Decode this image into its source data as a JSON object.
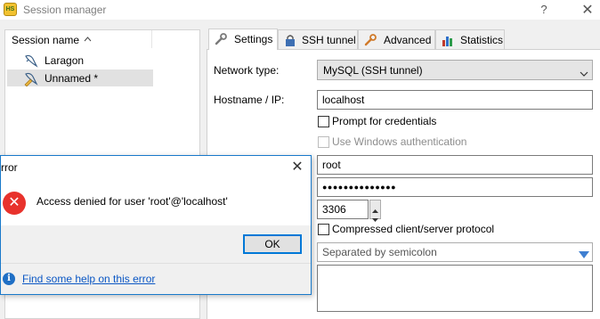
{
  "window": {
    "title": "Session manager",
    "app_icon_text": "HS",
    "help_label": "?",
    "close_label": "✕"
  },
  "sessions": {
    "column_header": "Session name",
    "sort_glyph": "^",
    "items": [
      {
        "label": "Laragon",
        "icon": "dolphin-icon",
        "selected": false
      },
      {
        "label": "Unnamed *",
        "icon": "dolphin-edit-icon",
        "selected": true
      }
    ]
  },
  "tabs": [
    {
      "label": "Settings",
      "icon": "wrench-icon",
      "active": true
    },
    {
      "label": "SSH tunnel",
      "icon": "lock-icon",
      "active": false
    },
    {
      "label": "Advanced",
      "icon": "wrench-icon",
      "active": false
    },
    {
      "label": "Statistics",
      "icon": "bar-chart-icon",
      "active": false
    }
  ],
  "settings": {
    "network_type_label": "Network type:",
    "network_type_value": "MySQL (SSH tunnel)",
    "hostname_label": "Hostname / IP:",
    "hostname_value": "localhost",
    "prompt_credentials_label": "Prompt for credentials",
    "windows_auth_label": "Use Windows authentication",
    "user_value": "root",
    "password_mask": "●●●●●●●●●●●●●●",
    "port_value": "3306",
    "compressed_label": "Compressed client/server protocol",
    "databases_placeholder": "Separated by semicolon"
  },
  "error_dialog": {
    "title": "rror",
    "close_label": "✕",
    "icon": "error-icon",
    "icon_glyph": "✕",
    "message": "Access denied for user 'root'@'localhost'",
    "ok_label": "OK",
    "info_glyph": "i",
    "help_link": "Find some help on this error"
  },
  "colors": {
    "accent": "#0078d7",
    "error": "#e8322c",
    "link": "#0b57c4"
  }
}
